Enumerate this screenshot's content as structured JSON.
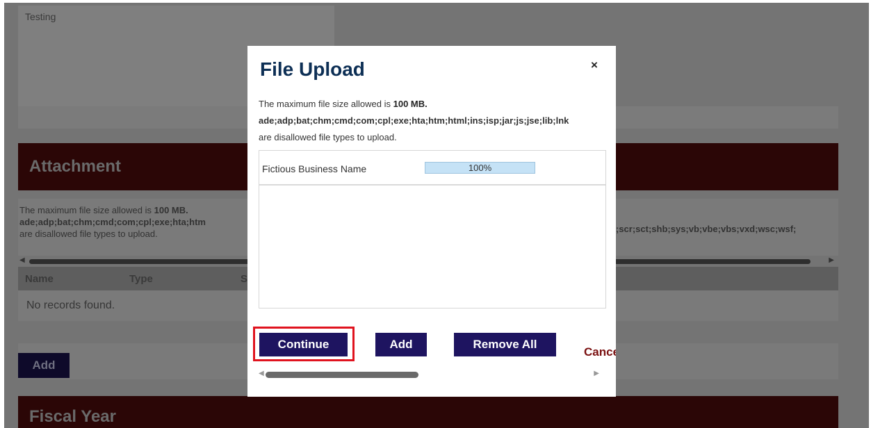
{
  "background": {
    "text_area_value": "Testing",
    "attachment_title": "Attachment",
    "max_size_prefix": "The maximum file size allowed is ",
    "max_size_value": "100 MB.",
    "disallowed_types_left": "ade;adp;bat;chm;cmd;com;cpl;exe;hta;htm",
    "disallowed_types_right": ";scr;sct;shb;sys;vb;vbe;vbs;vxd;wsc;wsf;",
    "disallowed_suffix": "are disallowed file types to upload.",
    "table_headers": [
      "Name",
      "Type"
    ],
    "table_header_partial": "S",
    "no_records": "No records found.",
    "add_button": "Add",
    "fiscal_year_title": "Fiscal Year"
  },
  "modal": {
    "title": "File Upload",
    "close_label": "×",
    "max_size_prefix": "The maximum file size allowed is ",
    "max_size_value": "100 MB.",
    "disallowed_types": "ade;adp;bat;chm;cmd;com;cpl;exe;hta;htm;html;ins;isp;jar;js;jse;lib;lnk",
    "disallowed_suffix": "are disallowed file types to upload.",
    "files": [
      {
        "name": "Fictious Business Name",
        "progress_label": "100%",
        "progress": 1.0
      }
    ],
    "buttons": {
      "continue": "Continue",
      "add": "Add",
      "remove_all": "Remove All",
      "cancel": "Cancel"
    }
  },
  "colors": {
    "modal_title": "#0d2f55",
    "button_bg": "#1e1460",
    "highlight": "#e0131e",
    "section_bar": "#2b0606",
    "overlay": "#747474"
  }
}
